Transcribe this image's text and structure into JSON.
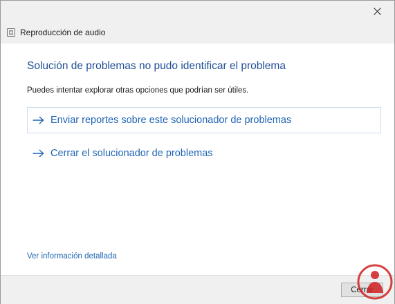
{
  "window": {
    "title": "Reproducción de audio",
    "icon": "audio-troubleshooter-icon"
  },
  "main": {
    "heading": "Solución de problemas no pudo identificar el problema",
    "subtext": "Puedes intentar explorar otras opciones que podrían ser útiles.",
    "options": [
      {
        "label": "Enviar reportes sobre este solucionador de problemas",
        "icon": "arrow-right-icon"
      },
      {
        "label": "Cerrar el solucionador de problemas",
        "icon": "arrow-right-icon"
      }
    ],
    "details_link": "Ver información detallada"
  },
  "footer": {
    "close_label": "Cerrar"
  },
  "colors": {
    "heading": "#1f4e96",
    "link": "#1f64b4",
    "watermark": "#cf1f1f"
  }
}
